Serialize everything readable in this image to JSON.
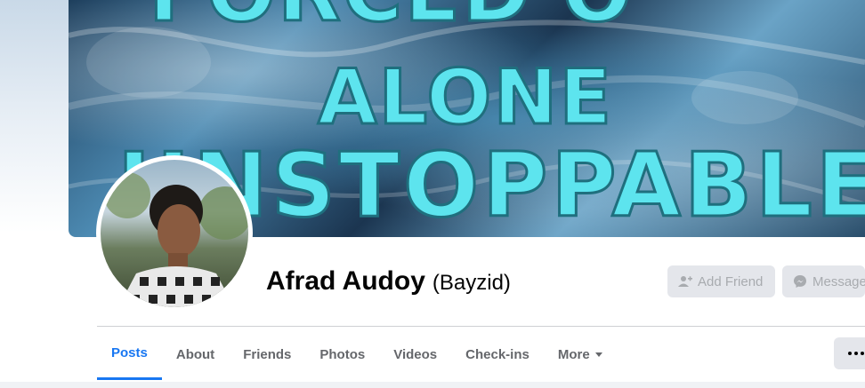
{
  "cover": {
    "line1": "FORCED O",
    "line2": "ALONE",
    "line3": "UNSTOPPABLE"
  },
  "profile": {
    "name": "Afrad Audoy",
    "alternate_name": "(Bayzid)"
  },
  "actions": {
    "add_friend": "Add Friend",
    "message": "Message"
  },
  "tabs": [
    {
      "label": "Posts",
      "active": true
    },
    {
      "label": "About"
    },
    {
      "label": "Friends"
    },
    {
      "label": "Photos"
    },
    {
      "label": "Videos"
    },
    {
      "label": "Check-ins"
    },
    {
      "label": "More"
    }
  ],
  "colors": {
    "accent": "#1877f2",
    "button_bg": "#e4e6eb",
    "cover_text": "#5de4ee"
  },
  "icons": {
    "add_friend": "person-add-icon",
    "message": "messenger-icon",
    "more_options": "ellipsis-icon",
    "more_tab": "caret-down-icon"
  }
}
